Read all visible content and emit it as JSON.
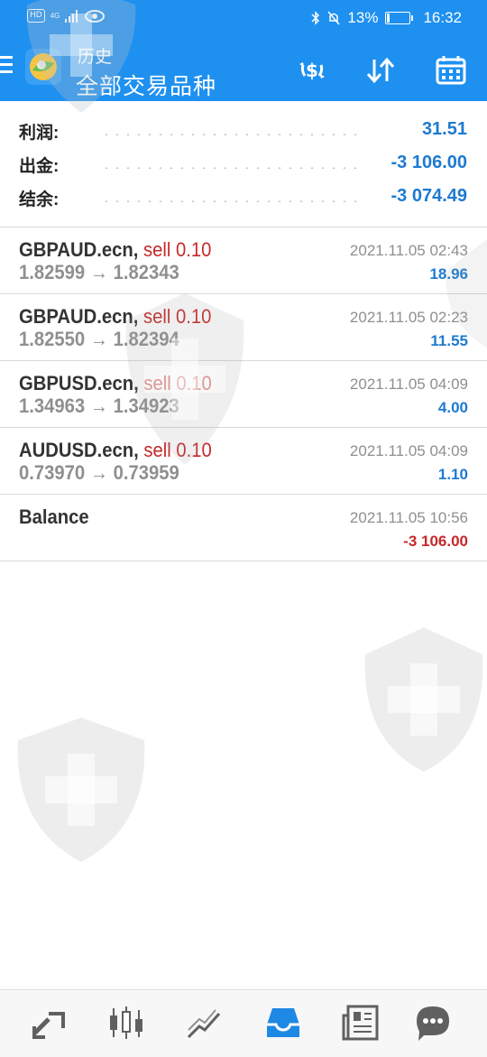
{
  "status_bar": {
    "hd": "HD",
    "network": "4G",
    "battery_percent": "13%",
    "battery_level": 0.13,
    "time": "16:32"
  },
  "header": {
    "title": "历史",
    "subtitle": "全部交易品种",
    "icons": [
      "menu-icon",
      "metatrader-logo",
      "deposit-withdraw-icon",
      "sort-icon",
      "calendar-icon"
    ]
  },
  "summary": [
    {
      "label": "利润:",
      "value": "31.51"
    },
    {
      "label": "出金:",
      "value": "-3 106.00"
    },
    {
      "label": "结余:",
      "value": "-3 074.49"
    }
  ],
  "trades": [
    {
      "symbol": "GBPAUD.ecn,",
      "side": "sell 0.10",
      "prices": "1.82599 → 1.82343",
      "date": "2021.11.05 02:43",
      "profit": "18.96",
      "negative": false
    },
    {
      "symbol": "GBPAUD.ecn,",
      "side": "sell 0.10",
      "prices": "1.82550 → 1.82394",
      "date": "2021.11.05 02:23",
      "profit": "11.55",
      "negative": false
    },
    {
      "symbol": "GBPUSD.ecn,",
      "side": "sell 0.10",
      "prices": "1.34963 → 1.34923",
      "date": "2021.11.05 04:09",
      "profit": "4.00",
      "negative": false
    },
    {
      "symbol": "AUDUSD.ecn,",
      "side": "sell 0.10",
      "prices": "0.73970 → 0.73959",
      "date": "2021.11.05 04:09",
      "profit": "1.10",
      "negative": false
    },
    {
      "symbol": "Balance",
      "side": "",
      "prices": "",
      "date": "2021.11.05 10:56",
      "profit": "-3 106.00",
      "negative": true
    }
  ],
  "bottom_nav": [
    "quotes-icon",
    "chart-icon",
    "trade-icon",
    "history-icon",
    "news-icon",
    "chat-icon"
  ],
  "colors": {
    "header_bg": "#1e90f0",
    "positive_blue": "#1e7ad0",
    "negative_red": "#c62828",
    "active_nav": "#1e88e5"
  }
}
